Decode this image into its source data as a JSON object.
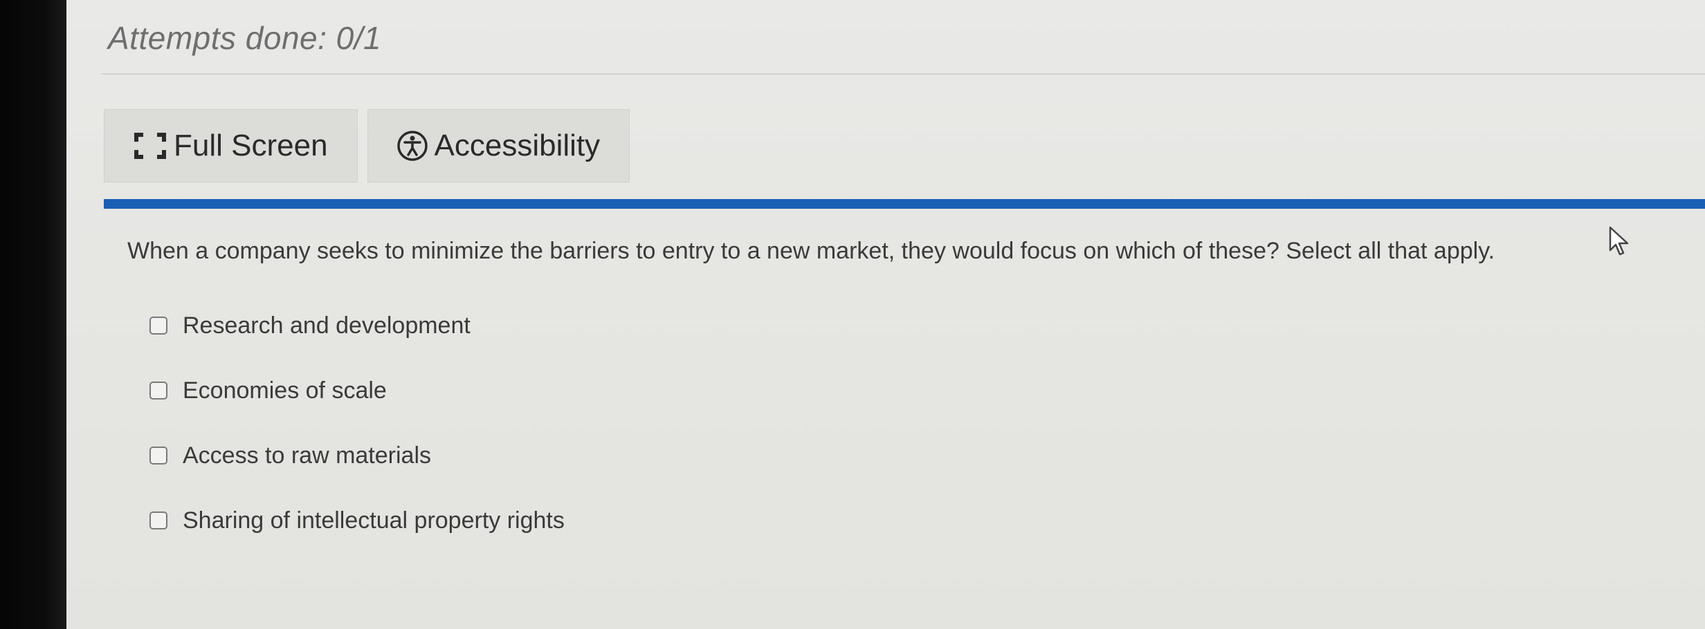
{
  "attempts": {
    "text": "Attempts done: 0/1"
  },
  "toolbar": {
    "full_screen_label": "Full Screen",
    "full_screen_icon": "fullscreen-icon",
    "accessibility_label": "Accessibility",
    "accessibility_icon": "accessibility-icon"
  },
  "colors": {
    "accent_rule": "#1b5fb5"
  },
  "question": {
    "text": "When a company seeks to minimize the barriers to entry to a new market, they would focus on which of these? Select all that apply.",
    "options": [
      {
        "label": "Research and development",
        "checked": false
      },
      {
        "label": "Economies of scale",
        "checked": false
      },
      {
        "label": "Access to raw materials",
        "checked": false
      },
      {
        "label": "Sharing of intellectual property rights",
        "checked": false
      }
    ]
  }
}
